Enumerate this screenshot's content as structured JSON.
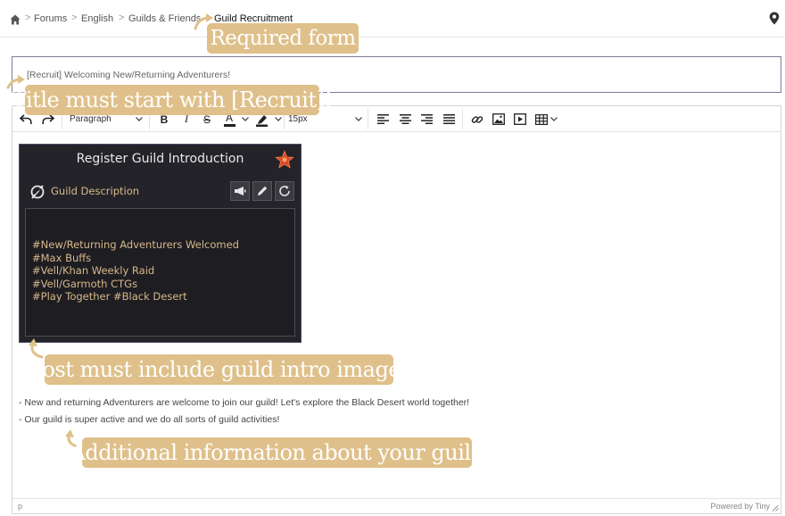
{
  "breadcrumb": {
    "items": [
      "Forums",
      "English",
      "Guilds & Friends",
      "Guild Recruitment"
    ],
    "separator": ">"
  },
  "title_field": {
    "value": "[Recruit] Welcoming New/Returning Adventurers!"
  },
  "toolbar": {
    "block_format": "Paragraph",
    "font_size": "15px",
    "bold_label": "B",
    "italic_label": "I",
    "strike_label": "S",
    "text_color_label": "A"
  },
  "guild_panel": {
    "title": "Register Guild Introduction",
    "description_label": "Guild Description",
    "lines": [
      "#New/Returning Adventurers Welcomed",
      "#Max Buffs",
      "#Vell/Khan Weekly Raid",
      "#Vell/Garmoth CTGs",
      "#Play Together #Black Desert"
    ]
  },
  "body_lines": [
    "- New and returning Adventurers are welcome to join our guild! Let's explore the Black Desert world together!",
    "- Our guild is super active and we do all sorts of guild activities!"
  ],
  "status_bar": {
    "path": "p",
    "powered_by": "Powered by Tiny"
  },
  "callouts": {
    "required_form": "Required form",
    "title_rule": "Title must start with [Recruit]!",
    "image_rule": "Post must include guild intro image!",
    "additional_info": "Additional information about your guild"
  },
  "colors": {
    "callout": "#dfc08a",
    "panel_bg": "#242329",
    "panel_text": "#d6b98a",
    "input_border": "#7a7f99"
  }
}
